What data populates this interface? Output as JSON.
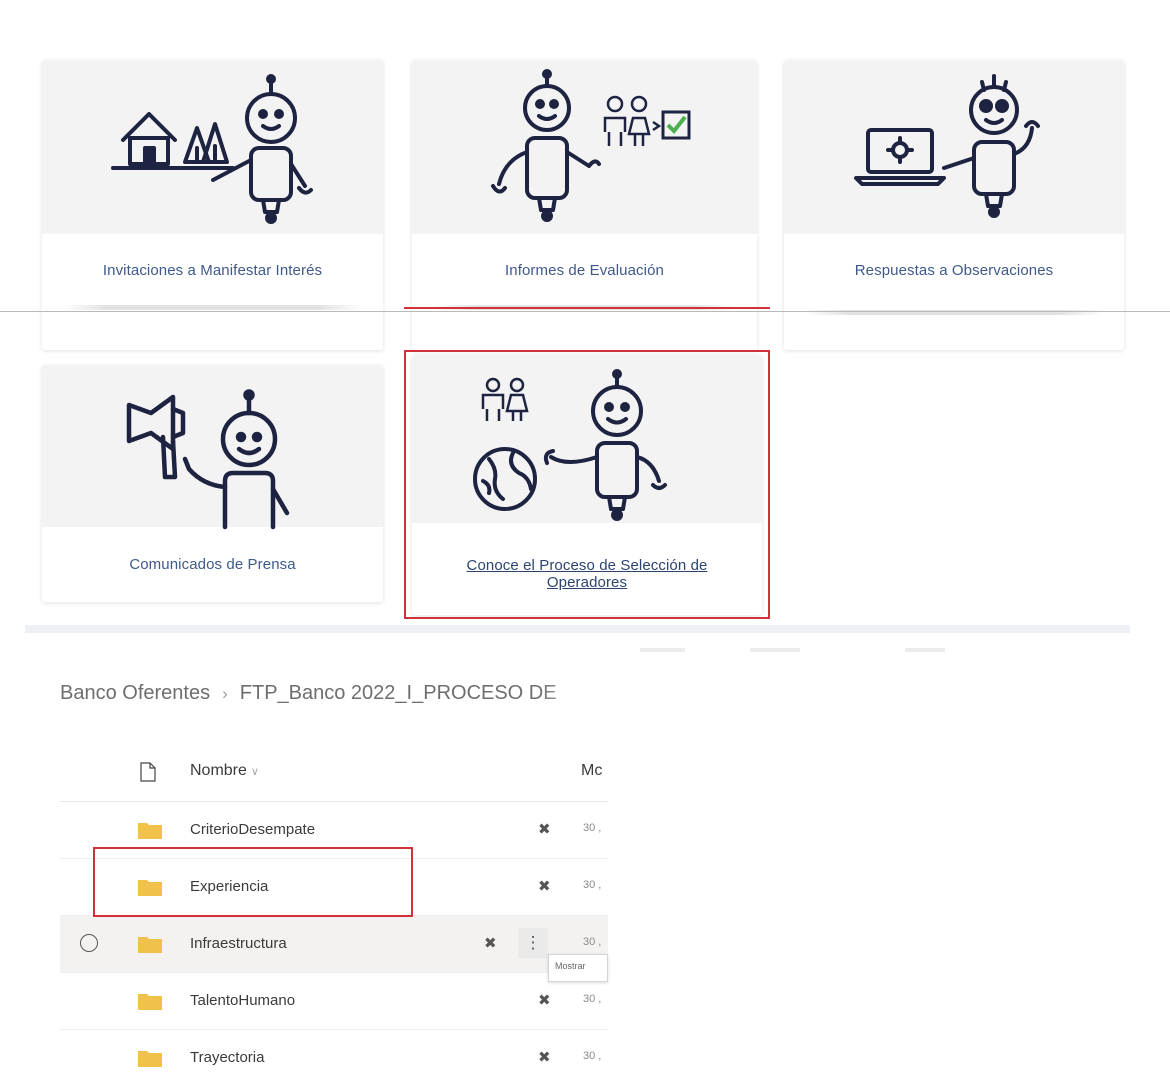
{
  "cards": [
    {
      "label": "Invitaciones a Manifestar Interés",
      "icon": "house-trees-robot"
    },
    {
      "label": "Informes de Evaluación",
      "icon": "people-checkbox-robot"
    },
    {
      "label": "Respuestas a Observaciones",
      "icon": "laptop-robot"
    },
    {
      "label": "Comunicados de Prensa",
      "icon": "megaphone-robot"
    },
    {
      "label": "Conoce el Proceso de Selección de Operadores",
      "icon": "globe-people-robot"
    }
  ],
  "breadcrumb": {
    "root": "Banco Oferentes",
    "current": "FTP_Banco 2022_I_PROCESO DE"
  },
  "file_list": {
    "column_name": "Nombre",
    "column_modified": "Mc",
    "rows": [
      {
        "name": "CriterioDesempate",
        "modified": "30 ,"
      },
      {
        "name": "Experiencia",
        "modified": "30 ,"
      },
      {
        "name": "Infraestructura",
        "modified": "30 ,"
      },
      {
        "name": "TalentoHumano",
        "modified": "30 ,"
      },
      {
        "name": "Trayectoria",
        "modified": "30 ,"
      }
    ],
    "tooltip": "Mostrar"
  },
  "colors": {
    "highlight": "#d0313c",
    "card_label": "#3f5a8a",
    "folder": "#f0c24a",
    "icon_stroke": "#1d2340"
  }
}
